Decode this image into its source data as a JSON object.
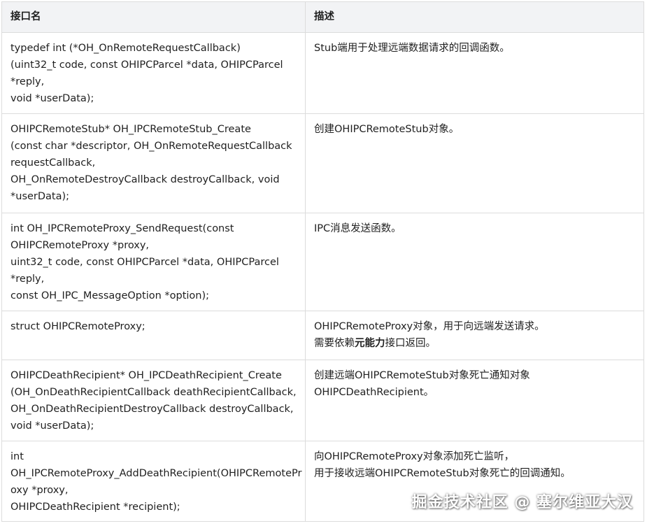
{
  "table": {
    "headers": [
      "接口名",
      "描述"
    ],
    "rows": [
      {
        "api": [
          "typedef int (*OH_OnRemoteRequestCallback)",
          "(uint32_t code, const OHIPCParcel *data, OHIPCParcel",
          "*reply,",
          "void *userData);"
        ],
        "desc": [
          [
            "Stub端用于处理远端数据请求的回调函数。"
          ]
        ]
      },
      {
        "api": [
          "OHIPCRemoteStub* OH_IPCRemoteStub_Create",
          "(const char *descriptor, OH_OnRemoteRequestCallback",
          "requestCallback,",
          "OH_OnRemoteDestroyCallback destroyCallback, void",
          "*userData);"
        ],
        "desc": [
          [
            "创建OHIPCRemoteStub对象。"
          ]
        ]
      },
      {
        "api": [
          "int OH_IPCRemoteProxy_SendRequest(const",
          "OHIPCRemoteProxy *proxy,",
          "uint32_t code, const OHIPCParcel *data, OHIPCParcel",
          "*reply,",
          "const OH_IPC_MessageOption *option);"
        ],
        "desc": [
          [
            "IPC消息发送函数。"
          ]
        ]
      },
      {
        "api": [
          "struct OHIPCRemoteProxy;"
        ],
        "desc": [
          [
            "OHIPCRemoteProxy对象，用于向远端发送请求。"
          ],
          [
            "需要依赖",
            "元能力",
            "接口返回。"
          ]
        ]
      },
      {
        "api": [
          "OHIPCDeathRecipient* OH_IPCDeathRecipient_Create",
          "(OH_OnDeathRecipientCallback deathRecipientCallback,",
          "OH_OnDeathRecipientDestroyCallback destroyCallback,",
          "void *userData);"
        ],
        "desc": [
          [
            "创建远端OHIPCRemoteStub对象死亡通知对象"
          ],
          [
            "OHIPCDeathRecipient。"
          ]
        ]
      },
      {
        "api": [
          "int",
          "OH_IPCRemoteProxy_AddDeathRecipient(OHIPCRemotePr",
          "oxy *proxy,",
          "OHIPCDeathRecipient *recipient);"
        ],
        "desc": [
          [
            "向OHIPCRemoteProxy对象添加死亡监听，"
          ],
          [
            "用于接收远端OHIPCRemoteStub对象死亡的回调通知。"
          ]
        ]
      }
    ]
  },
  "watermark": "掘金技术社区 @ 塞尔维亚大汉"
}
